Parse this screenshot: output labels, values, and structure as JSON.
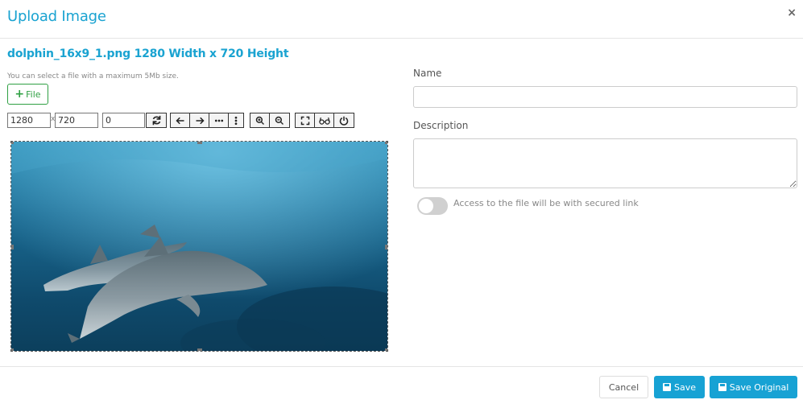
{
  "dialog": {
    "title": "Upload Image",
    "close_label": "×"
  },
  "file": {
    "title": "dolphin_16x9_1.png 1280 Width x 720 Height",
    "hint": "You can select a file with a maximum 5Mb size.",
    "button_label": "File"
  },
  "toolbar": {
    "width": "1280",
    "separator": "x",
    "height": "720",
    "rotation": "0"
  },
  "form": {
    "name_label": "Name",
    "name_value": "",
    "description_label": "Description",
    "description_value": "",
    "secure_link_label": "Access to the file will be with secured link",
    "secure_link_enabled": false
  },
  "footer": {
    "cancel_label": "Cancel",
    "save_label": "Save",
    "save_original_label": "Save Original"
  },
  "colors": {
    "accent": "#1aa3d1",
    "file_button": "#2fa043"
  }
}
